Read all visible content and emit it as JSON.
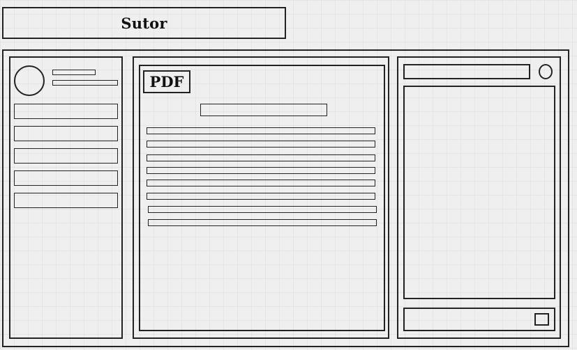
{
  "header": {
    "title": "Sutor"
  },
  "document": {
    "badge": "PDF"
  },
  "sidebar": {
    "nav_items": [
      "",
      "",
      "",
      "",
      ""
    ]
  }
}
